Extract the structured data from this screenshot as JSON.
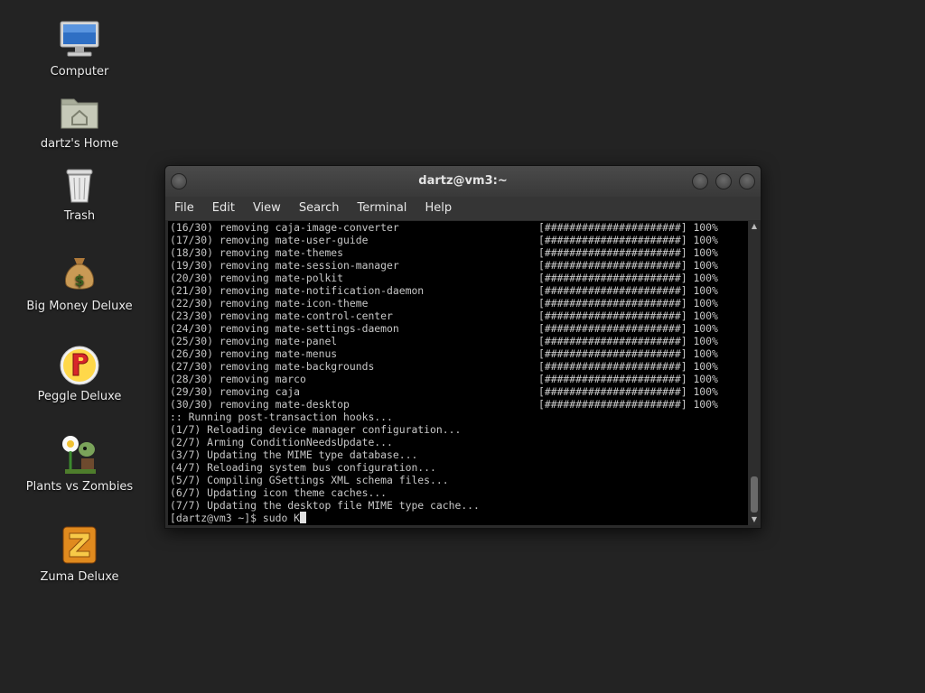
{
  "desktop": {
    "icons": [
      {
        "label": "Computer"
      },
      {
        "label": "dartz's Home"
      },
      {
        "label": "Trash"
      },
      {
        "label": "Big Money Deluxe"
      },
      {
        "label": "Peggle Deluxe"
      },
      {
        "label": "Plants vs Zombies"
      },
      {
        "label": "Zuma Deluxe"
      }
    ]
  },
  "window": {
    "title": "dartz@vm3:~",
    "menu": [
      "File",
      "Edit",
      "View",
      "Search",
      "Terminal",
      "Help"
    ]
  },
  "terminal": {
    "progress_bar": "[######################]",
    "progress_pct": "100%",
    "removal_lines": [
      "(16/30) removing caja-image-converter",
      "(17/30) removing mate-user-guide",
      "(18/30) removing mate-themes",
      "(19/30) removing mate-session-manager",
      "(20/30) removing mate-polkit",
      "(21/30) removing mate-notification-daemon",
      "(22/30) removing mate-icon-theme",
      "(23/30) removing mate-control-center",
      "(24/30) removing mate-settings-daemon",
      "(25/30) removing mate-panel",
      "(26/30) removing mate-menus",
      "(27/30) removing mate-backgrounds",
      "(28/30) removing marco",
      "(29/30) removing caja",
      "(30/30) removing mate-desktop"
    ],
    "hook_lines": [
      ":: Running post-transaction hooks...",
      "(1/7) Reloading device manager configuration...",
      "(2/7) Arming ConditionNeedsUpdate...",
      "(3/7) Updating the MIME type database...",
      "(4/7) Reloading system bus configuration...",
      "(5/7) Compiling GSettings XML schema files...",
      "(6/7) Updating icon theme caches...",
      "(7/7) Updating the desktop file MIME type cache..."
    ],
    "prompt": "[dartz@vm3 ~]$ ",
    "command": "sudo K"
  }
}
